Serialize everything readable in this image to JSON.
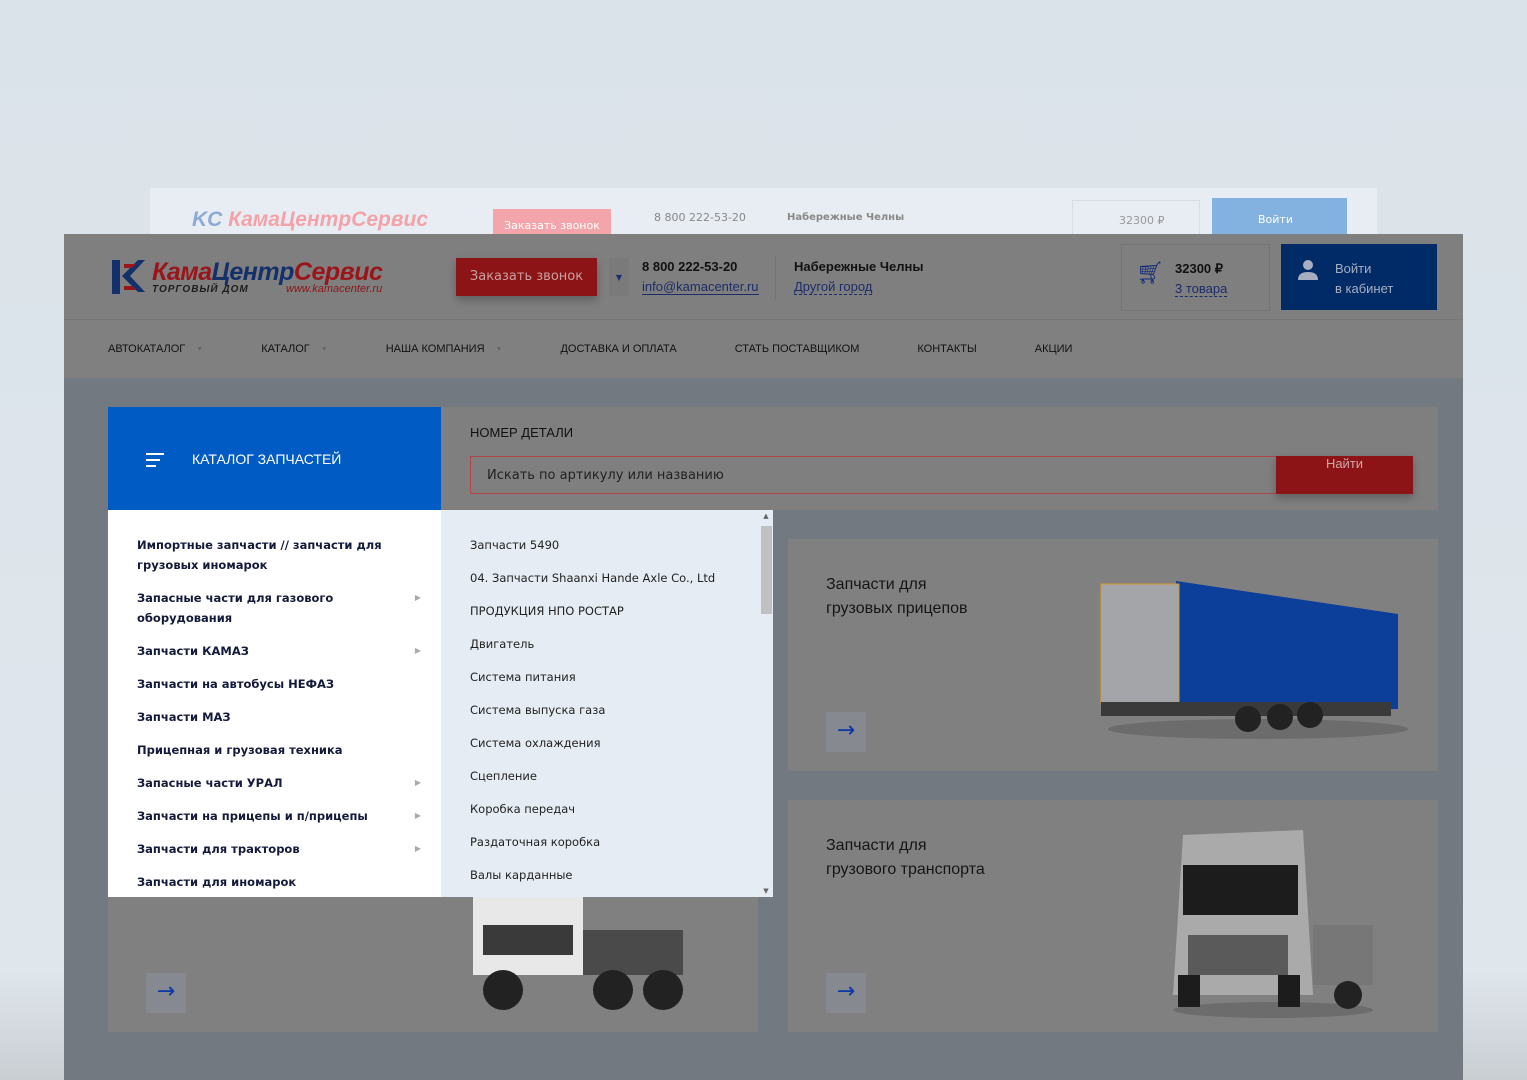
{
  "header": {
    "logo_name_a": "Кама",
    "logo_name_b": "Центр",
    "logo_name_c": "Сервис",
    "logo_sub": "ТОРГОВЫЙ ДОМ",
    "logo_url": "www.kamacenter.ru",
    "call_button": "Заказать звонок",
    "phone": "8 800 222-53-20",
    "email": "info@kamacenter.ru",
    "city": "Набережные Челны",
    "city_link": "Другой город",
    "cart_sum": "32300 ₽",
    "cart_count": "3 товара",
    "login_line1": "Войти",
    "login_line2": "в кабинет"
  },
  "nav": [
    {
      "label": "АВТОКАТАЛОГ",
      "dropdown": true
    },
    {
      "label": "КАТАЛОГ",
      "dropdown": true
    },
    {
      "label": "НАША КОМПАНИЯ",
      "dropdown": true
    },
    {
      "label": "ДОСТАВКА И ОПЛАТА"
    },
    {
      "label": "СТАТЬ ПОСТАВЩИКОМ"
    },
    {
      "label": "КОНТАКТЫ"
    },
    {
      "label": "АКЦИИ"
    }
  ],
  "catalog": {
    "title": "КАТАЛОГ ЗАПЧАСТЕЙ"
  },
  "search": {
    "label": "НОМЕР ДЕТАЛИ",
    "placeholder": "Искать по артикулу или названию",
    "button": "Найти"
  },
  "menu_left": [
    {
      "label": "Импортные запчасти // запчасти для грузовых иномарок"
    },
    {
      "label": "Запасные части для газового оборудования",
      "arrow": true
    },
    {
      "label": "Запчасти КАМАЗ",
      "arrow": true
    },
    {
      "label": "Запчасти на автобусы НЕФАЗ"
    },
    {
      "label": "Запчасти МАЗ"
    },
    {
      "label": "Прицепная и грузовая техника"
    },
    {
      "label": "Запасные части УРАЛ",
      "arrow": true
    },
    {
      "label": "Запчасти на прицепы и п/прицепы",
      "arrow": true
    },
    {
      "label": "Запчасти для тракторов",
      "arrow": true
    },
    {
      "label": "Запчасти для иномарок"
    }
  ],
  "menu_right": [
    "Запчасти 5490",
    "04. Запчасти Shaanxi Hande Axle Co., Ltd",
    "ПРОДУКЦИЯ НПО РОСТАР",
    "Двигатель",
    "Система питания",
    "Система выпуска газа",
    "Система охлаждения",
    "Сцепление",
    "Коробка передач",
    "Раздаточная коробка",
    "Валы карданные"
  ],
  "cards": [
    {
      "title1": "Запчасти для",
      "title2": "грузовых прицепов"
    },
    {
      "title1": "Запчасти для",
      "title2": "грузового транспорта"
    }
  ],
  "colors": {
    "brand_blue": "#005bc4",
    "brand_red": "#8c1416",
    "dark_blue": "#002b67"
  }
}
